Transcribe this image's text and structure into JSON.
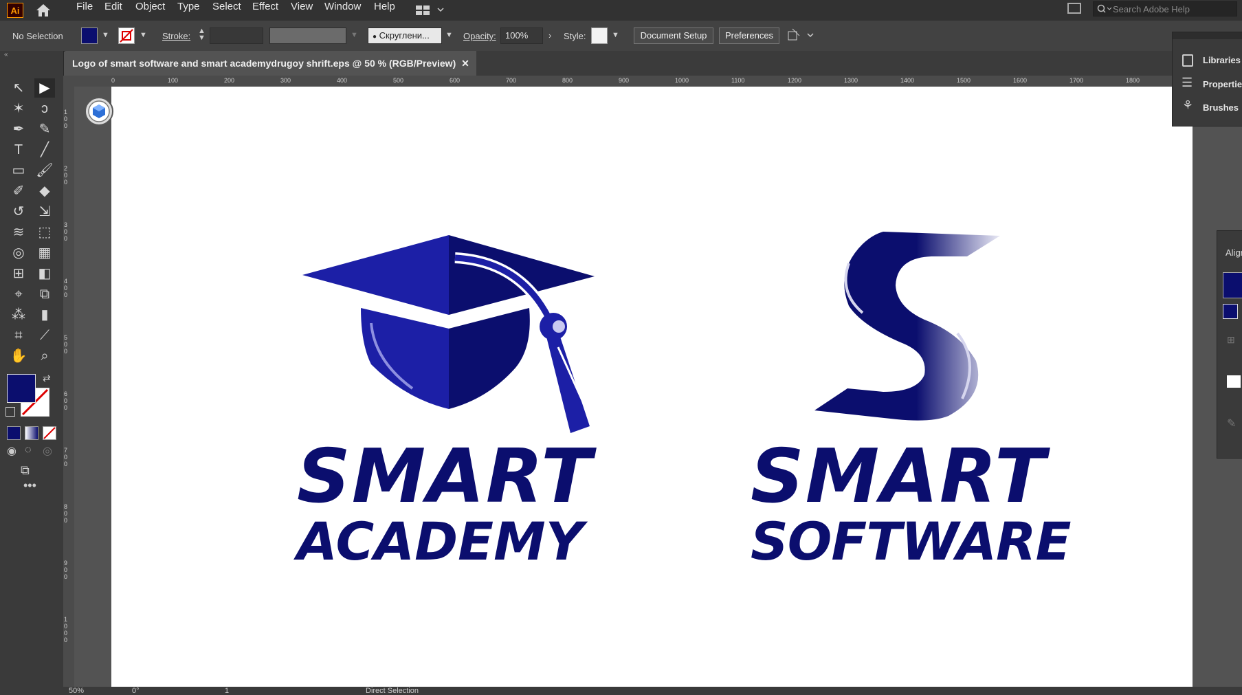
{
  "app": {
    "logo": "Ai"
  },
  "menu": [
    "File",
    "Edit",
    "Object",
    "Type",
    "Select",
    "Effect",
    "View",
    "Window",
    "Help"
  ],
  "search": {
    "placeholder": "Search Adobe Help"
  },
  "control": {
    "selection": "No Selection",
    "stroke_label": "Stroke:",
    "brush_value": "Скруглени...",
    "opacity_label": "Opacity:",
    "opacity_value": "100%",
    "style_label": "Style:",
    "document_setup": "Document Setup",
    "preferences": "Preferences"
  },
  "tab": {
    "title": "Logo of smart software and smart academydrugoy shrift.eps @ 50 % (RGB/Preview)"
  },
  "ruler_top": [
    "0",
    "100",
    "200",
    "300",
    "400",
    "500",
    "600",
    "700",
    "800",
    "900",
    "1000",
    "1100",
    "1200",
    "1300",
    "1400",
    "1500",
    "1600",
    "1700",
    "1800"
  ],
  "ruler_left": [
    "100",
    "200",
    "300",
    "400",
    "500",
    "600",
    "700",
    "800",
    "900",
    "1000"
  ],
  "panels": {
    "libraries": "Libraries",
    "properties": "Properties",
    "brushes": "Brushes",
    "align": "Align"
  },
  "status": {
    "zoom": "50%",
    "rotation": "0°",
    "artboard": "1",
    "tool": "Direct Selection"
  },
  "artwork": {
    "academy_line1": "SMART",
    "academy_line2": "ACADEMY",
    "software_line1": "SMART",
    "software_line2": "SOFTWARE"
  },
  "colors": {
    "fill": "#0b0e6e",
    "brand": "#1c1fa6",
    "accent": "#ff9a00"
  }
}
